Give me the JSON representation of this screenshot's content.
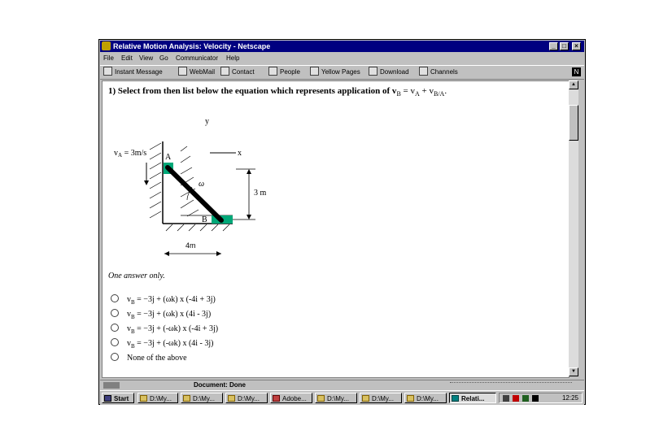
{
  "window": {
    "title": "Relative Motion Analysis: Velocity - Netscape"
  },
  "menu": [
    "File",
    "Edit",
    "View",
    "Go",
    "Communicator",
    "Help"
  ],
  "toolbar": [
    "Instant Message",
    "WebMail",
    "Contact",
    "People",
    "Yellow Pages",
    "Download",
    "Channels"
  ],
  "question": {
    "prefix": "1) Select from then list below the equation which represents application of v",
    "b": "B",
    "eq": " = v",
    "a": "A",
    "plus": " + v",
    "ba": "B/A",
    "end": "."
  },
  "diagram": {
    "y_label": "y",
    "x_label": "x",
    "va_label": "v",
    "va_sub": "A",
    "va_value": " = 3m/s",
    "point_a": "A",
    "point_b": "B",
    "omega": "ω",
    "height": "3 m",
    "width": "4m"
  },
  "answer_hint": "One answer only.",
  "options": [
    {
      "v": "v",
      "sub": "B",
      "text": " = −3j + (ωk) x (-4i + 3j)"
    },
    {
      "v": "v",
      "sub": "B",
      "text": " = −3j + (ωk) x (4i - 3j)"
    },
    {
      "v": "v",
      "sub": "B",
      "text": " = −3j + (-ωk) x (-4i + 3j)"
    },
    {
      "v": "v",
      "sub": "B",
      "text": " = −3j + (-ωk) x (4i - 3j)"
    },
    {
      "v": "",
      "sub": "",
      "text": "None of the above"
    }
  ],
  "status": {
    "text": "Document: Done"
  },
  "taskbar": {
    "start": "Start",
    "items": [
      "D:\\My...",
      "D:\\My...",
      "D:\\My...",
      "Adobe...",
      "D:\\My...",
      "D:\\My...",
      "D:\\My...",
      "Relati..."
    ],
    "clock": "12:25"
  },
  "colors": {
    "titlebar": "#000080",
    "chrome": "#c0c0c0",
    "collar": "#00a878"
  }
}
